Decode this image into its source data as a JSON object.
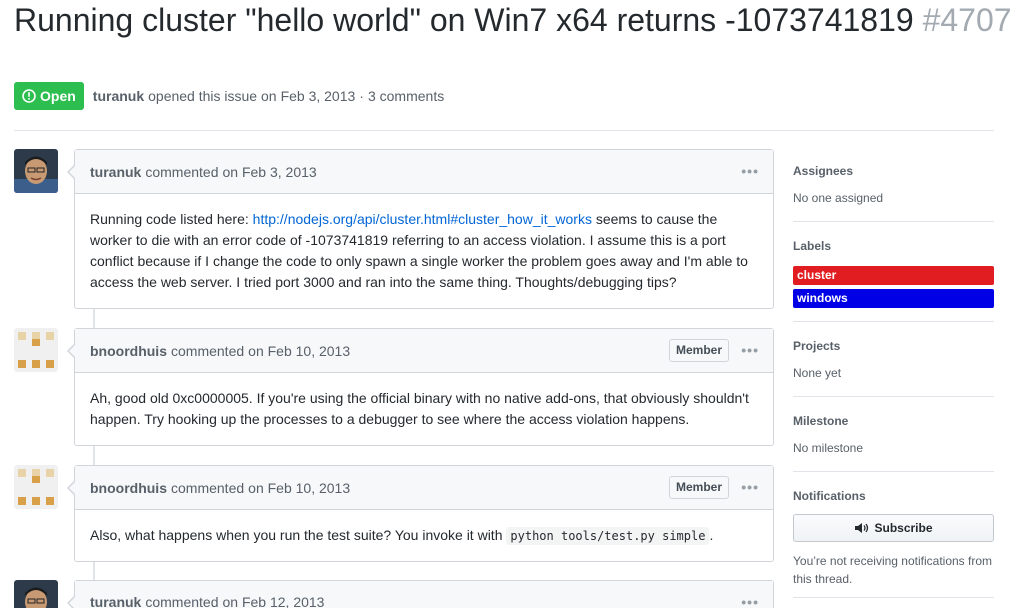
{
  "issue": {
    "title": "Running cluster \"hello world\" on Win7 x64 returns -1073741819",
    "number": "#4707",
    "state": "Open",
    "author": "turanuk",
    "opened_text": "opened this issue on",
    "opened_date": "Feb 3, 2013",
    "separator": "·",
    "comments_count": "3 comments"
  },
  "comments": [
    {
      "author": "turanuk",
      "action": "commented",
      "date": "on Feb 3, 2013",
      "body_before_link": "Running code listed here: ",
      "link": "http://nodejs.org/api/cluster.html#cluster_how_it_works",
      "body_after_link": " seems to cause the worker to die with an error code of -1073741819 referring to an access violation. I assume this is a port conflict because if I change the code to only spawn a single worker the problem goes away and I'm able to access the web server. I tried port 3000 and ran into the same thing. Thoughts/debugging tips?"
    },
    {
      "author": "bnoordhuis",
      "action": "commented",
      "date": "on Feb 10, 2013",
      "badge": "Member",
      "body": "Ah, good old 0xc0000005. If you're using the official binary with no native add-ons, that obviously shouldn't happen. Try hooking up the processes to a debugger to see where the access violation happens."
    },
    {
      "author": "bnoordhuis",
      "action": "commented",
      "date": "on Feb 10, 2013",
      "badge": "Member",
      "body_before_code": "Also, what happens when you run the test suite? You invoke it with ",
      "code": "python tools/test.py simple",
      "body_after_code": "."
    },
    {
      "author": "turanuk",
      "action": "commented",
      "date": "on Feb 12, 2013"
    }
  ],
  "sidebar": {
    "assignees_heading": "Assignees",
    "assignees_value": "No one assigned",
    "labels_heading": "Labels",
    "labels": [
      {
        "name": "cluster",
        "color": "#e11d21"
      },
      {
        "name": "windows",
        "color": "#0000e6"
      }
    ],
    "projects_heading": "Projects",
    "projects_value": "None yet",
    "milestone_heading": "Milestone",
    "milestone_value": "No milestone",
    "notifications_heading": "Notifications",
    "subscribe_label": "Subscribe",
    "notifications_note": "You’re not receiving notifications from this thread."
  },
  "colors": {
    "open_green": "#2cbe4e",
    "link_blue": "#0366d6"
  }
}
